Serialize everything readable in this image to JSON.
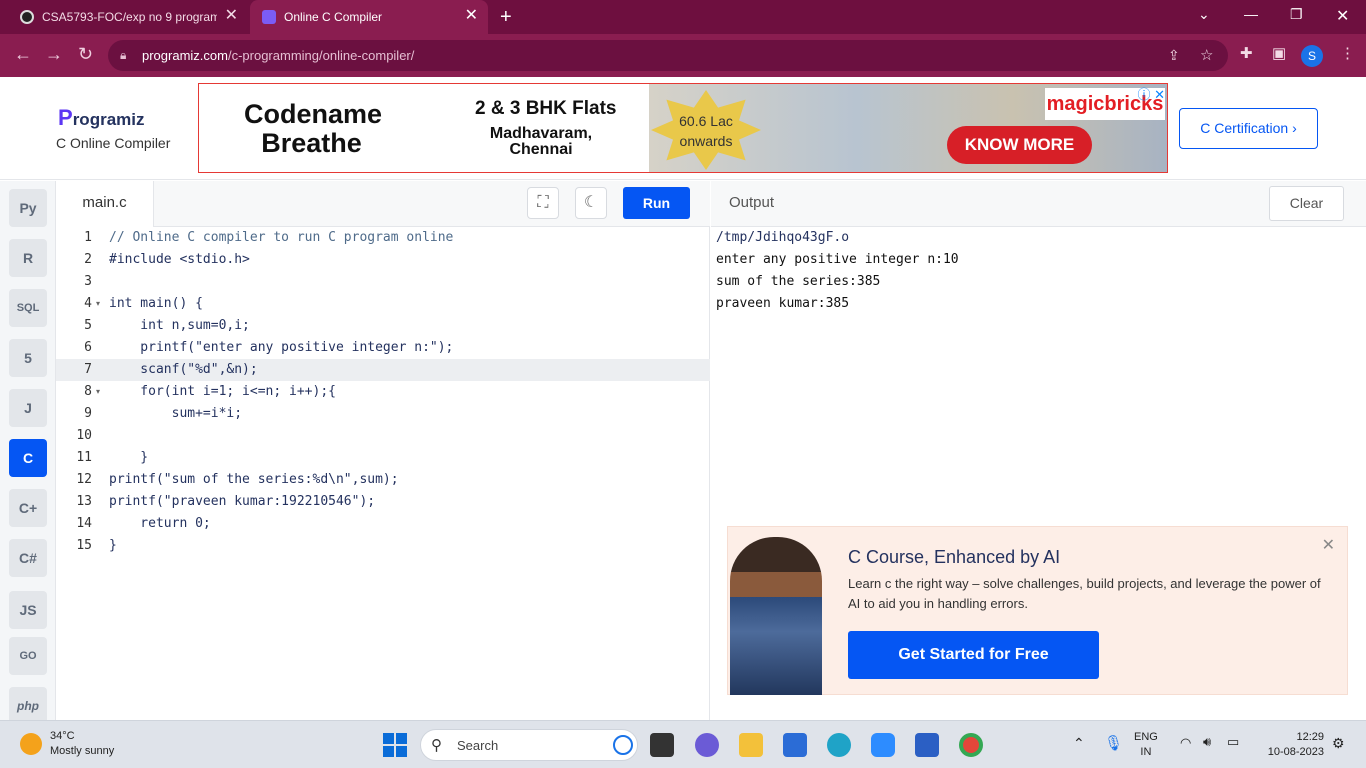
{
  "browser": {
    "tabs": [
      {
        "title": "CSA5793-FOC/exp no 9 program",
        "active": false
      },
      {
        "title": "Online C Compiler",
        "active": true
      }
    ],
    "url_host": "programiz.com",
    "url_path": "/c-programming/online-compiler/",
    "profile_initial": "S"
  },
  "header": {
    "logo": "rogramiz",
    "logo_mark": "P",
    "subtitle": "C Online Compiler",
    "certification_button": "C Certification ›"
  },
  "ad": {
    "brand_line1": "Codename",
    "brand_line2": "Breathe",
    "flats": "2 & 3 BHK Flats",
    "location_line1": "Madhavaram,",
    "location_line2": "Chennai",
    "price_line1": "60.6 Lac",
    "price_line2": "onwards",
    "advertiser": "magicbricks",
    "cta": "KNOW MORE"
  },
  "sidebar": {
    "languages": [
      {
        "id": "python",
        "label": "Py",
        "active": false
      },
      {
        "id": "r",
        "label": "R",
        "active": false
      },
      {
        "id": "sql",
        "label": "SQL",
        "active": false
      },
      {
        "id": "html",
        "label": "5",
        "active": false
      },
      {
        "id": "java",
        "label": "J",
        "active": false
      },
      {
        "id": "c",
        "label": "C",
        "active": true
      },
      {
        "id": "cpp",
        "label": "C+",
        "active": false
      },
      {
        "id": "csharp",
        "label": "C#",
        "active": false
      },
      {
        "id": "js",
        "label": "JS",
        "active": false
      },
      {
        "id": "go",
        "label": "GO",
        "active": false
      },
      {
        "id": "php",
        "label": "php",
        "active": false
      }
    ]
  },
  "editor": {
    "filename": "main.c",
    "run_label": "Run",
    "active_line": 7,
    "lines": [
      "// Online C compiler to run C program online",
      "#include <stdio.h>",
      "",
      "int main() {",
      "    int n,sum=0,i;",
      "    printf(\"enter any positive integer n:\");",
      "    scanf(\"%d\",&n);",
      "    for(int i=1; i<=n; i++);{",
      "        sum+=i*i;",
      "",
      "    }",
      "printf(\"sum of the series:%d\\n\",sum);",
      "printf(\"praveen kumar:192210546\");",
      "    return 0;",
      "}"
    ]
  },
  "output": {
    "title": "Output",
    "clear_label": "Clear",
    "lines": [
      "/tmp/Jdihqo43gF.o",
      "enter any positive integer n:10",
      "sum of the series:385",
      "praveen kumar:385"
    ]
  },
  "promo": {
    "title": "C Course, Enhanced by AI",
    "text": "Learn c the right way – solve challenges, build projects, and leverage the power of AI to aid you in handling errors.",
    "button": "Get Started for Free"
  },
  "taskbar": {
    "temperature": "34°C",
    "weather": "Mostly sunny",
    "search_placeholder": "Search",
    "language": "ENG",
    "region": "IN",
    "time": "12:29",
    "date": "10-08-2023"
  },
  "colors": {
    "accent": "#0556f3",
    "browser_frame": "#6e0f3f",
    "ad_cta": "#d71f27"
  }
}
